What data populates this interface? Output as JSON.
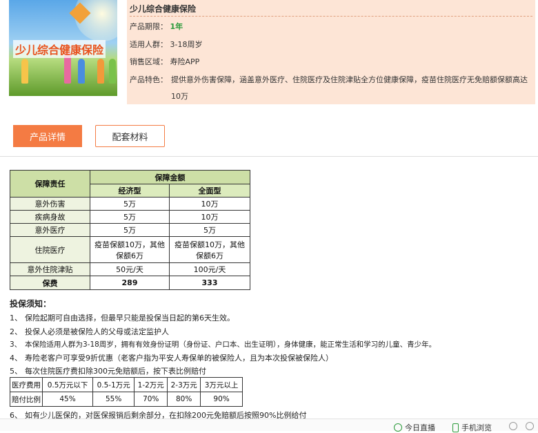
{
  "hero": {
    "caption": "少儿综合健康保险"
  },
  "info": {
    "title": "少儿综合健康保险",
    "term_label": "产品期限：",
    "term_value": "1年",
    "age_label": "适用人群：",
    "age_value": "3-18周岁",
    "region_label": "销售区域：",
    "region_value": "寿险APP",
    "feature_label": "产品特色：",
    "feature_value": "提供意外伤害保障，涵盖意外医疗、住院医疗及住院津贴全方位健康保障，疫苗住院医疗无免赔额保额高达10万"
  },
  "tabs": {
    "detail": "产品详情",
    "materials": "配套材料"
  },
  "coverage_table": {
    "col_resp": "保障责任",
    "col_amount": "保障金额",
    "col_economy": "经济型",
    "col_full": "全面型",
    "rows": [
      {
        "name": "意外伤害",
        "economy": "5万",
        "full": "10万"
      },
      {
        "name": "疾病身故",
        "economy": "5万",
        "full": "10万"
      },
      {
        "name": "意外医疗",
        "economy": "5万",
        "full": "5万"
      },
      {
        "name": "住院医疗",
        "economy": "疫苗保额10万，其他保额6万",
        "full": "疫苗保额10万，其他保额6万"
      },
      {
        "name": "意外住院津贴",
        "economy": "50元/天",
        "full": "100元/天"
      },
      {
        "name": "保费",
        "economy": "289",
        "full": "333"
      }
    ]
  },
  "notes": {
    "title": "投保须知：",
    "items": [
      {
        "num": "1、",
        "text": "保险起期可自由选择，但最早只能是投保当日起的第6天生效。"
      },
      {
        "num": "2、",
        "text": "投保人必须是被保险人的父母或法定监护人"
      },
      {
        "num": "3、",
        "text": "本保险适用人群为3-18周岁，拥有有效身份证明（身份证、户口本、出生证明），身体健康，能正常生活和学习的儿童、青少年。"
      },
      {
        "num": "4、",
        "text": "寿险老客户可享受9折优惠（老客户指为平安人寿保单的被保险人，且为本次投保被保险人）"
      },
      {
        "num": "5、",
        "text": "每次住院医疗费扣除300元免赔额后，按下表比例赔付"
      },
      {
        "num": "6、",
        "text": "如有少儿医保的，对医保报销后剩余部分，在扣除200元免赔额后按照90%比例给付"
      }
    ]
  },
  "ratio_table": {
    "row1_label": "医疗费用",
    "row2_label": "赔付比例",
    "cols": [
      "0.5万元以下",
      "0.5-1万元",
      "1-2万元",
      "2-3万元",
      "3万元以上"
    ],
    "ratios": [
      "45%",
      "55%",
      "70%",
      "80%",
      "90%"
    ]
  },
  "bottombar": {
    "live": "今日直播",
    "mobile": "手机浏览"
  }
}
